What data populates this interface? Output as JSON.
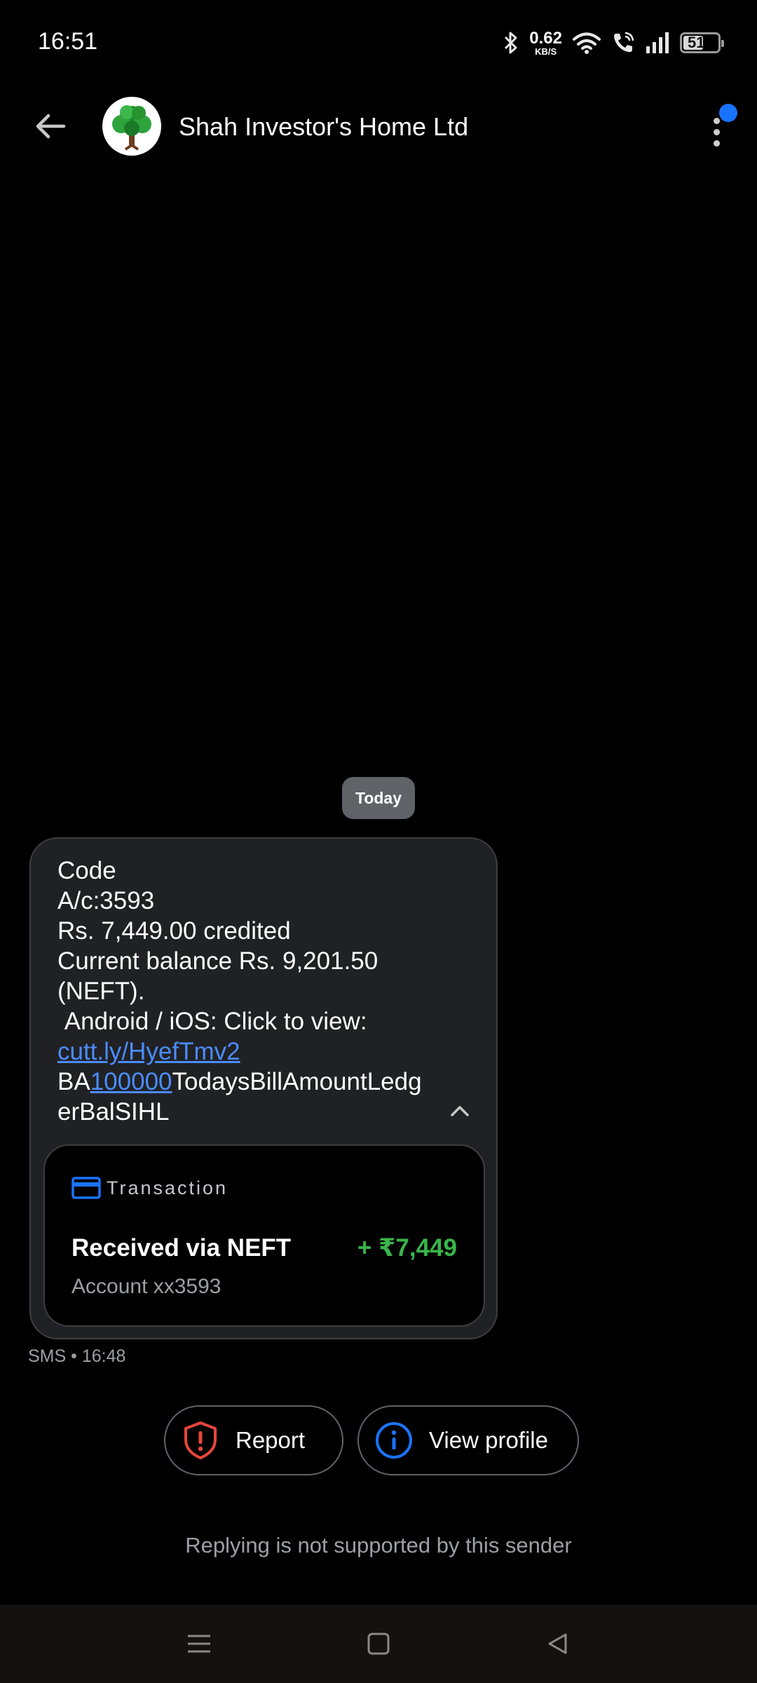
{
  "status_bar": {
    "time": "16:51",
    "net_speed_value": "0.62",
    "net_speed_unit": "KB/S",
    "battery_level": "51",
    "icons": [
      "bluetooth-icon",
      "wifi-icon",
      "wifi-calling-icon",
      "signal-icon",
      "battery-icon"
    ]
  },
  "header": {
    "sender_name": "Shah Investor's Home Ltd",
    "avatar_icon": "tree-icon",
    "notification_color": "#1a73ff"
  },
  "conversation": {
    "date_chip": "Today",
    "message": {
      "line_1": "Code",
      "line_2": "A/c:3593",
      "line_3": "Rs. 7,449.00 credited",
      "line_4": "Current balance Rs. 9,201.50",
      "line_5": "(NEFT).",
      "line_6": " Android / iOS: Click to view:",
      "link": "cutt.ly/HyefTmv2",
      "ba_prefix": "BA",
      "ba_link": "100000",
      "ba_suffix_1": "TodaysBillAmountLedg",
      "ba_suffix_2": "erBalSIHL"
    },
    "transaction": {
      "label": "Transaction",
      "title": "Received via NEFT",
      "amount": "+ ₹7,449",
      "account": "Account xx3593",
      "amount_color": "#39b54a"
    },
    "meta": "SMS • 16:48"
  },
  "actions": {
    "report_label": "Report",
    "view_profile_label": "View profile"
  },
  "footer": {
    "reply_note": "Replying is not supported by this sender"
  },
  "nav": {
    "icons": [
      "menu-icon",
      "home-icon",
      "back-triangle-icon"
    ]
  }
}
